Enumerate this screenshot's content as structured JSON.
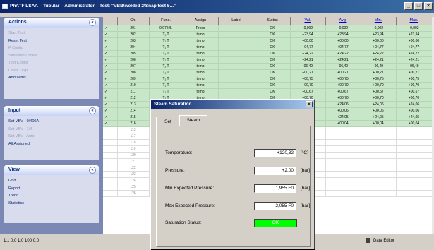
{
  "window": {
    "title": "PhATF LSAA – Tubular – Administrator – Test: \"VBB\\welded 2\\Snap test 5…\"",
    "min": "_",
    "max": "□",
    "close": "×"
  },
  "sidebar": {
    "actions": {
      "title": "Actions",
      "collapse": "«",
      "items": [
        "Start Test",
        "Reset Test",
        "P Config",
        "Simulation Sheet",
        "Test Config",
        "Offset Disp",
        "Add Items"
      ]
    },
    "input": {
      "title": "Input",
      "collapse": "«",
      "items": [
        "Set VBV - 0/400A",
        "Set VBV - 1/4",
        "Set VBV - Auto",
        "All Assigned"
      ]
    },
    "view": {
      "title": "View",
      "collapse": "«",
      "items": [
        "Grid",
        "Report",
        "Trend",
        "Statistics"
      ]
    }
  },
  "table": {
    "headers": [
      "",
      "Ch.",
      "Func.",
      "Assign",
      "Label",
      "Status",
      "Val.",
      "Avg.",
      "Min.",
      "Max."
    ],
    "link_headers": [
      "Val.",
      "Avg.",
      "Min.",
      "Max."
    ],
    "rows": [
      [
        "✓",
        "201",
        "0.07 k/L",
        "Press",
        "",
        "OK",
        "-0,002",
        "-0,002",
        "-0,002",
        "-0,002"
      ],
      [
        "✓",
        "202",
        "T₁ T",
        "temp",
        "",
        "OK",
        "+23,94",
        "+23,94",
        "+23,94",
        "+23,94"
      ],
      [
        "✓",
        "203",
        "T₁ T",
        "temp",
        "",
        "OK",
        "+00,00",
        "+00,00",
        "+00,00",
        "+00,00"
      ],
      [
        "✓",
        "204",
        "T₁ T",
        "temp",
        "",
        "OK",
        "+04,77",
        "+04,77",
        "+04,77",
        "+04,77"
      ],
      [
        "✓",
        "205",
        "T₁ T",
        "temp",
        "",
        "OK",
        "+24,22",
        "+24,22",
        "+24,22",
        "+24,22"
      ],
      [
        "✓",
        "206",
        "T₁ T",
        "temp",
        "",
        "OK",
        "+24,21",
        "+24,21",
        "+24,21",
        "+24,21"
      ],
      [
        "✓",
        "207",
        "T₁ T",
        "temp",
        "",
        "OK",
        "-06,49",
        "-06,49",
        "-06,49",
        "-06,49"
      ],
      [
        "✓",
        "208",
        "T₁ T",
        "temp",
        "",
        "OK",
        "+00,21",
        "+00,21",
        "+00,21",
        "+00,21"
      ],
      [
        "✓",
        "209",
        "T₁ T",
        "temp",
        "",
        "OK",
        "+00,75",
        "+00,75",
        "+00,75",
        "+00,75"
      ],
      [
        "✓",
        "210",
        "T₁ T",
        "temp",
        "",
        "OK",
        "+00,70",
        "+00,70",
        "+00,70",
        "+00,70"
      ],
      [
        "✓",
        "211",
        "T₁ T",
        "temp",
        "",
        "OK",
        "+00,67",
        "+00,67",
        "+00,67",
        "+00,67"
      ],
      [
        "✓",
        "212",
        "T₁ T",
        "temp",
        "",
        "OK",
        "+00,70",
        "+00,70",
        "+00,70",
        "+00,70"
      ],
      [
        "✓",
        "213",
        "T₁ T",
        "temp",
        "",
        "OK",
        "+24,06",
        "+24,06",
        "+24,06",
        "+24,06"
      ],
      [
        "✓",
        "214",
        "T₁ T",
        "temp",
        "",
        "OK",
        "+00,06",
        "+00,06",
        "+00,06",
        "+00,06"
      ],
      [
        "✓",
        "215",
        "T₁ T",
        "temp",
        "",
        "OK",
        "+24,05",
        "+24,05",
        "+24,05",
        "+24,05"
      ],
      [
        "✓",
        "216",
        "T₁ T",
        "temp",
        "",
        "OK",
        "+00,04",
        "+00,04",
        "+00,04",
        "+00,04"
      ]
    ],
    "empty_rows": [
      "113",
      "117",
      "118",
      "119",
      "120",
      "121",
      "122",
      "123",
      "124",
      "125",
      "126"
    ]
  },
  "statusbar": {
    "left": "1:1  0:0     1:0 100 0:0",
    "right": "Data Editor"
  },
  "dialog": {
    "title": "Steam Saturation",
    "close": "×",
    "tabs": [
      "Set",
      "Steam"
    ],
    "fields": [
      {
        "label": "Temperature:",
        "value": "+120,32",
        "unit": "[°C]"
      },
      {
        "label": "Pressure:",
        "value": "+2,00",
        "unit": "[bar]"
      },
      {
        "label": "Min Expected Pressure:",
        "value": "1,955 F0",
        "unit": "[bar]"
      },
      {
        "label": "Max Expected Pressure:",
        "value": "2,055 F0",
        "unit": "[bar]"
      }
    ],
    "saturation_label": "Saturation Status:",
    "saturation_value": "OK",
    "saturation_color": "#00ff00"
  }
}
